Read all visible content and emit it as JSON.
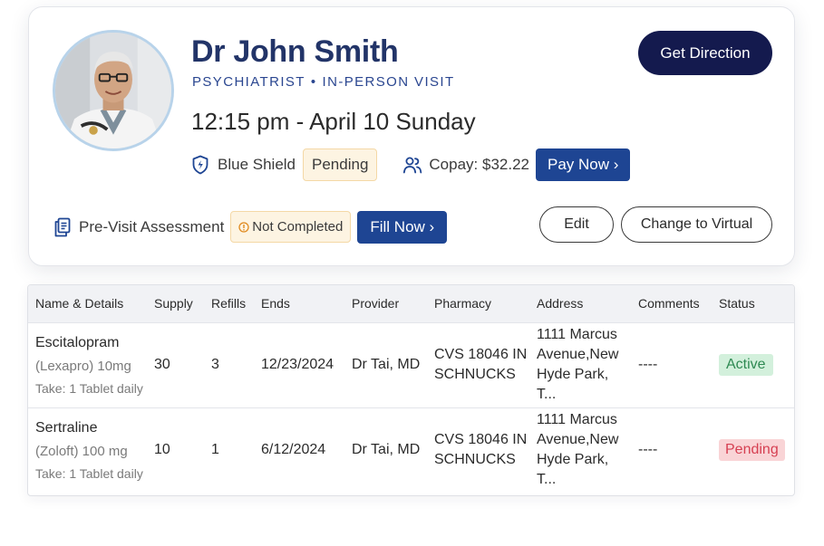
{
  "doctor": {
    "name": "Dr John Smith",
    "specialty": "PSYCHIATRIST",
    "separator": "•",
    "visit_type": "IN-PERSON VISIT",
    "photo": "doctor-portrait"
  },
  "appointment": {
    "time": "12:15 pm",
    "dash": " - ",
    "date": "April 10 Sunday"
  },
  "actions": {
    "get_direction": "Get Direction",
    "edit": "Edit",
    "change_to_virtual": "Change to Virtual"
  },
  "insurance": {
    "icon": "shield-icon",
    "provider": "Blue Shield",
    "status": "Pending"
  },
  "copay": {
    "icon": "users-icon",
    "label": "Copay: $32.22",
    "pay_button": "Pay Now ›"
  },
  "previsit": {
    "icon": "clipboard-icon",
    "label": "Pre-Visit Assessment",
    "status_icon": "warning-icon",
    "status": "Not Completed",
    "fill_button": "Fill Now ›"
  },
  "colors": {
    "navy": "#141a4e",
    "primary": "#1e4593",
    "title": "#223468",
    "pending_bg": "#fdf4e2",
    "active_bg": "#d3f0dc",
    "active_text": "#2f8a53",
    "danger_bg": "#f9d4d6",
    "danger_text": "#d64052"
  },
  "table": {
    "columns": [
      "Name & Details",
      "Supply",
      "Refills",
      "Ends",
      "Provider",
      "Pharmacy",
      "Address",
      "Comments",
      "Status"
    ],
    "rows": [
      {
        "name": "Escitalopram",
        "detail": "(Lexapro) 10mg",
        "take": "Take: 1 Tablet daily",
        "supply": "30",
        "refills": "3",
        "ends": "12/23/2024",
        "provider": "Dr Tai, MD",
        "pharmacy_line1": "CVS 18046 IN",
        "pharmacy_line2": "SCHNUCKS",
        "address_line1": "1111 Marcus",
        "address_line2": "Avenue,New",
        "address_line3": "Hyde Park, T...",
        "comments": "----",
        "status": "Active"
      },
      {
        "name": "Sertraline",
        "detail": "(Zoloft) 100 mg",
        "take": "Take: 1 Tablet daily",
        "supply": "10",
        "refills": "1",
        "ends": "6/12/2024",
        "provider": "Dr Tai, MD",
        "pharmacy_line1": "CVS 18046 IN",
        "pharmacy_line2": "SCHNUCKS",
        "address_line1": "1111 Marcus",
        "address_line2": "Avenue,New",
        "address_line3": "Hyde Park, T...",
        "comments": "----",
        "status": "Pending"
      }
    ]
  }
}
